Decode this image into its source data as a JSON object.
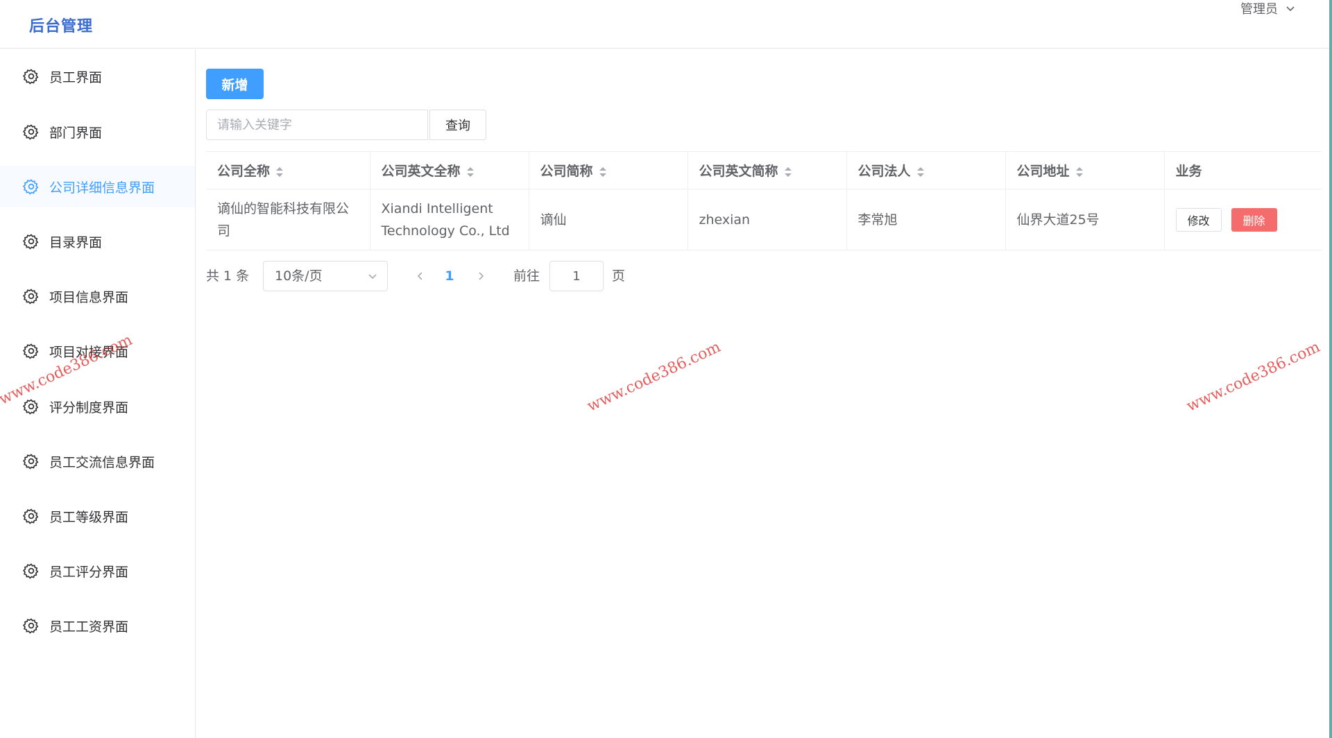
{
  "header": {
    "brand": "后台管理",
    "user": "管理员"
  },
  "sidebar": {
    "items": [
      {
        "label": "员工界面",
        "icon": "gear-icon",
        "active": false
      },
      {
        "label": "部门界面",
        "icon": "gear-icon",
        "active": false
      },
      {
        "label": "公司详细信息界面",
        "icon": "gear-icon",
        "active": true
      },
      {
        "label": "目录界面",
        "icon": "gear-icon",
        "active": false
      },
      {
        "label": "项目信息界面",
        "icon": "gear-icon",
        "active": false
      },
      {
        "label": "项目对接界面",
        "icon": "gear-icon",
        "active": false
      },
      {
        "label": "评分制度界面",
        "icon": "gear-icon",
        "active": false
      },
      {
        "label": "员工交流信息界面",
        "icon": "gear-icon",
        "active": false
      },
      {
        "label": "员工等级界面",
        "icon": "gear-icon",
        "active": false
      },
      {
        "label": "员工评分界面",
        "icon": "gear-icon",
        "active": false
      },
      {
        "label": "员工工资界面",
        "icon": "gear-icon",
        "active": false
      }
    ]
  },
  "toolbar": {
    "add_label": "新增",
    "search_placeholder": "请输入关键字",
    "search_value": "",
    "query_label": "查询"
  },
  "table": {
    "columns": [
      "公司全称",
      "公司英文全称",
      "公司简称",
      "公司英文简称",
      "公司法人",
      "公司地址",
      "业务"
    ],
    "rows": [
      {
        "full_name": "谪仙的智能科技有限公司",
        "english_full_name": "Xiandi Intelligent Technology Co., Ltd",
        "short_name": "谪仙",
        "english_short_name": "zhexian",
        "legal_person": "李常旭",
        "address": "仙界大道25号",
        "edit_label": "修改",
        "delete_label": "删除"
      }
    ]
  },
  "pagination": {
    "total": "共 1 条",
    "page_size": "10条/页",
    "current_page": "1",
    "goto_label": "前往",
    "goto_value": "1",
    "goto_suffix": "页"
  },
  "watermark": "www.code386.com",
  "colors": {
    "primary": "#409eff",
    "danger": "#f56c6c",
    "brand": "#3a6bd1",
    "watermark": "#dc2828"
  }
}
